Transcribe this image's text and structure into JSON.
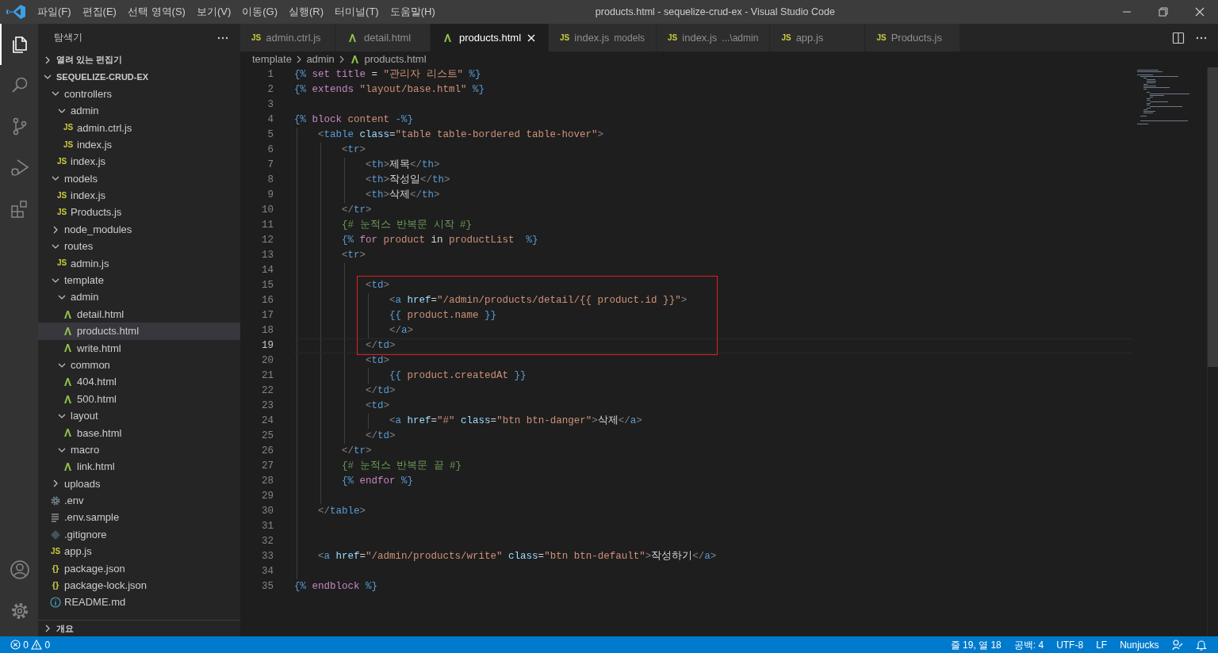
{
  "title_bar": {
    "menu": [
      "파일(F)",
      "편집(E)",
      "선택 영역(S)",
      "보기(V)",
      "이동(G)",
      "실행(R)",
      "터미널(T)",
      "도움말(H)"
    ],
    "title": "products.html - sequelize-crud-ex - Visual Studio Code"
  },
  "activity_bar": {
    "items": [
      {
        "selected": true
      },
      {
        "selected": false
      },
      {
        "selected": false
      },
      {
        "selected": false
      },
      {
        "selected": false
      }
    ]
  },
  "sidebar": {
    "title": "탐색기",
    "sections": [
      {
        "label": "열려 있는 편집기",
        "expanded": false
      },
      {
        "label": "SEQUELIZE-CRUD-EX",
        "expanded": true,
        "children": [
          {
            "label": "controllers",
            "kind": "folder",
            "expanded": true,
            "selected": false,
            "children": [
              {
                "label": "admin",
                "kind": "folder",
                "expanded": true,
                "selected": false,
                "children": [
                  {
                    "label": "admin.ctrl.js",
                    "kind": "js",
                    "badge": "JS",
                    "selected": false
                  },
                  {
                    "label": "index.js",
                    "kind": "js",
                    "badge": "JS",
                    "selected": false
                  }
                ]
              },
              {
                "label": "index.js",
                "kind": "js",
                "badge": "JS",
                "selected": false
              }
            ]
          },
          {
            "label": "models",
            "kind": "folder",
            "expanded": true,
            "selected": false,
            "children": [
              {
                "label": "index.js",
                "kind": "js",
                "badge": "JS",
                "selected": false
              },
              {
                "label": "Products.js",
                "kind": "js",
                "badge": "JS",
                "selected": false
              }
            ]
          },
          {
            "label": "node_modules",
            "kind": "folder",
            "expanded": false,
            "selected": false
          },
          {
            "label": "routes",
            "kind": "folder",
            "expanded": true,
            "selected": false,
            "children": [
              {
                "label": "admin.js",
                "kind": "js",
                "badge": "JS",
                "selected": false
              }
            ]
          },
          {
            "label": "template",
            "kind": "folder",
            "expanded": true,
            "selected": false,
            "children": [
              {
                "label": "admin",
                "kind": "folder",
                "expanded": true,
                "selected": false,
                "children": [
                  {
                    "label": "detail.html",
                    "kind": "nunjucks",
                    "selected": false
                  },
                  {
                    "label": "products.html",
                    "kind": "nunjucks",
                    "selected": true
                  },
                  {
                    "label": "write.html",
                    "kind": "nunjucks",
                    "selected": false
                  }
                ]
              },
              {
                "label": "common",
                "kind": "folder",
                "expanded": true,
                "selected": false,
                "children": [
                  {
                    "label": "404.html",
                    "kind": "nunjucks",
                    "selected": false
                  },
                  {
                    "label": "500.html",
                    "kind": "nunjucks",
                    "selected": false
                  }
                ]
              },
              {
                "label": "layout",
                "kind": "folder",
                "expanded": true,
                "selected": false,
                "children": [
                  {
                    "label": "base.html",
                    "kind": "nunjucks",
                    "selected": false
                  }
                ]
              },
              {
                "label": "macro",
                "kind": "folder",
                "expanded": true,
                "selected": false,
                "children": [
                  {
                    "label": "link.html",
                    "kind": "nunjucks",
                    "selected": false
                  }
                ]
              }
            ]
          },
          {
            "label": "uploads",
            "kind": "folder",
            "expanded": false,
            "selected": false
          },
          {
            "label": ".env",
            "kind": "settings",
            "selected": false
          },
          {
            "label": ".env.sample",
            "kind": "text",
            "selected": false
          },
          {
            "label": ".gitignore",
            "kind": "git",
            "selected": false
          },
          {
            "label": "app.js",
            "kind": "js",
            "badge": "JS",
            "selected": false
          },
          {
            "label": "package.json",
            "kind": "json",
            "badge": "{}",
            "selected": false
          },
          {
            "label": "package-lock.json",
            "kind": "json",
            "badge": "{}",
            "selected": false
          },
          {
            "label": "README.md",
            "kind": "info",
            "selected": false
          }
        ]
      }
    ],
    "outline": {
      "label": "개요",
      "expanded": false
    }
  },
  "tabs": [
    {
      "label": "admin.ctrl.js",
      "kind": "js",
      "badge": "JS",
      "selected": false
    },
    {
      "label": "detail.html",
      "kind": "nunjucks",
      "selected": false
    },
    {
      "label": "products.html",
      "kind": "nunjucks",
      "selected": true
    },
    {
      "label": "index.js",
      "description": "models",
      "kind": "js",
      "badge": "JS",
      "selected": false
    },
    {
      "label": "index.js",
      "description": "...\\admin",
      "kind": "js",
      "badge": "JS",
      "selected": false
    },
    {
      "label": "app.js",
      "kind": "js",
      "badge": "JS",
      "selected": false
    },
    {
      "label": "Products.js",
      "kind": "js",
      "badge": "JS",
      "selected": false
    }
  ],
  "breadcrumb": [
    {
      "label": "template",
      "kind": "folder"
    },
    {
      "label": "admin",
      "kind": "folder"
    },
    {
      "label": "products.html",
      "kind": "nunjucks"
    }
  ],
  "editor": {
    "lines": [
      {
        "number": "1",
        "boxed": false,
        "current": false,
        "tokens": [
          {
            "kind": "delim",
            "text": "{% "
          },
          {
            "kind": "keyword",
            "text": "set title"
          },
          {
            "kind": "text",
            "text": " = "
          },
          {
            "kind": "string",
            "text": "\"관리자 리스트\""
          },
          {
            "kind": "delim",
            "text": " %}"
          }
        ]
      },
      {
        "number": "2",
        "boxed": false,
        "current": false,
        "tokens": [
          {
            "kind": "delim",
            "text": "{% "
          },
          {
            "kind": "keyword",
            "text": "extends "
          },
          {
            "kind": "string",
            "text": "\"layout/base.html\""
          },
          {
            "kind": "delim",
            "text": " %}"
          }
        ]
      },
      {
        "number": "3",
        "boxed": false,
        "current": false
      },
      {
        "number": "4",
        "boxed": false,
        "current": false,
        "tokens": [
          {
            "kind": "delim",
            "text": "{% "
          },
          {
            "kind": "keyword",
            "text": "block "
          },
          {
            "kind": "var",
            "text": "content "
          },
          {
            "kind": "delim",
            "text": "-%}"
          }
        ]
      },
      {
        "number": "5",
        "boxed": false,
        "current": false,
        "tokens": [
          {
            "kind": "punct",
            "text": "    <"
          },
          {
            "kind": "tag",
            "text": "table"
          },
          {
            "kind": "attr",
            "text": " class"
          },
          {
            "kind": "text",
            "text": "="
          },
          {
            "kind": "string",
            "text": "\"table table-bordered table-hover\""
          },
          {
            "kind": "punct",
            "text": ">"
          }
        ]
      },
      {
        "number": "6",
        "boxed": false,
        "current": false,
        "tokens": [
          {
            "kind": "punct",
            "text": "        <"
          },
          {
            "kind": "tag",
            "text": "tr"
          },
          {
            "kind": "punct",
            "text": ">"
          }
        ]
      },
      {
        "number": "7",
        "boxed": false,
        "current": false,
        "tokens": [
          {
            "kind": "punct",
            "text": "            <"
          },
          {
            "kind": "tag",
            "text": "th"
          },
          {
            "kind": "punct",
            "text": ">"
          },
          {
            "kind": "text",
            "text": "제목"
          },
          {
            "kind": "punct",
            "text": "</"
          },
          {
            "kind": "tag",
            "text": "th"
          },
          {
            "kind": "punct",
            "text": ">"
          }
        ]
      },
      {
        "number": "8",
        "boxed": false,
        "current": false,
        "tokens": [
          {
            "kind": "punct",
            "text": "            <"
          },
          {
            "kind": "tag",
            "text": "th"
          },
          {
            "kind": "punct",
            "text": ">"
          },
          {
            "kind": "text",
            "text": "작성일"
          },
          {
            "kind": "punct",
            "text": "</"
          },
          {
            "kind": "tag",
            "text": "th"
          },
          {
            "kind": "punct",
            "text": ">"
          }
        ]
      },
      {
        "number": "9",
        "boxed": false,
        "current": false,
        "tokens": [
          {
            "kind": "punct",
            "text": "            <"
          },
          {
            "kind": "tag",
            "text": "th"
          },
          {
            "kind": "punct",
            "text": ">"
          },
          {
            "kind": "text",
            "text": "삭제"
          },
          {
            "kind": "punct",
            "text": "</"
          },
          {
            "kind": "tag",
            "text": "th"
          },
          {
            "kind": "punct",
            "text": ">"
          }
        ]
      },
      {
        "number": "10",
        "boxed": false,
        "current": false,
        "tokens": [
          {
            "kind": "punct",
            "text": "        </"
          },
          {
            "kind": "tag",
            "text": "tr"
          },
          {
            "kind": "punct",
            "text": ">"
          }
        ]
      },
      {
        "number": "11",
        "boxed": false,
        "current": false,
        "tokens": [
          {
            "kind": "comment",
            "text": "        {# 눈적스 반복문 시작 #}"
          }
        ]
      },
      {
        "number": "12",
        "boxed": false,
        "current": false,
        "tokens": [
          {
            "kind": "delim",
            "text": "        {% "
          },
          {
            "kind": "keyword",
            "text": "for "
          },
          {
            "kind": "var",
            "text": "product "
          },
          {
            "kind": "text",
            "text": "in "
          },
          {
            "kind": "var",
            "text": "productList  "
          },
          {
            "kind": "delim",
            "text": "%}"
          }
        ]
      },
      {
        "number": "13",
        "boxed": false,
        "current": false,
        "tokens": [
          {
            "kind": "punct",
            "text": "        <"
          },
          {
            "kind": "tag",
            "text": "tr"
          },
          {
            "kind": "punct",
            "text": ">"
          }
        ]
      },
      {
        "number": "14",
        "boxed": false,
        "current": false
      },
      {
        "number": "15",
        "boxed": true,
        "current": false,
        "tokens": [
          {
            "kind": "punct",
            "text": "            <"
          },
          {
            "kind": "tag",
            "text": "td"
          },
          {
            "kind": "punct",
            "text": ">"
          }
        ]
      },
      {
        "number": "16",
        "boxed": true,
        "current": false,
        "tokens": [
          {
            "kind": "punct",
            "text": "                <"
          },
          {
            "kind": "tag",
            "text": "a"
          },
          {
            "kind": "attr",
            "text": " href"
          },
          {
            "kind": "text",
            "text": "="
          },
          {
            "kind": "string",
            "text": "\"/admin/products/detail/{{ product.id }}\""
          },
          {
            "kind": "punct",
            "text": ">"
          }
        ]
      },
      {
        "number": "17",
        "boxed": true,
        "current": false,
        "tokens": [
          {
            "kind": "delim",
            "text": "                {{ "
          },
          {
            "kind": "var",
            "text": "product.name "
          },
          {
            "kind": "delim",
            "text": "}}"
          }
        ]
      },
      {
        "number": "18",
        "boxed": true,
        "current": false,
        "tokens": [
          {
            "kind": "punct",
            "text": "                </"
          },
          {
            "kind": "tag",
            "text": "a"
          },
          {
            "kind": "punct",
            "text": ">"
          }
        ]
      },
      {
        "number": "19",
        "boxed": true,
        "current": true,
        "tokens": [
          {
            "kind": "punct",
            "text": "            </"
          },
          {
            "kind": "tag",
            "text": "td"
          },
          {
            "kind": "punct",
            "text": ">"
          }
        ]
      },
      {
        "number": "20",
        "boxed": false,
        "current": false,
        "tokens": [
          {
            "kind": "punct",
            "text": "            <"
          },
          {
            "kind": "tag",
            "text": "td"
          },
          {
            "kind": "punct",
            "text": ">"
          }
        ]
      },
      {
        "number": "21",
        "boxed": false,
        "current": false,
        "tokens": [
          {
            "kind": "delim",
            "text": "                {{ "
          },
          {
            "kind": "var",
            "text": "product.createdAt "
          },
          {
            "kind": "delim",
            "text": "}}"
          }
        ]
      },
      {
        "number": "22",
        "boxed": false,
        "current": false,
        "tokens": [
          {
            "kind": "punct",
            "text": "            </"
          },
          {
            "kind": "tag",
            "text": "td"
          },
          {
            "kind": "punct",
            "text": ">"
          }
        ]
      },
      {
        "number": "23",
        "boxed": false,
        "current": false,
        "tokens": [
          {
            "kind": "punct",
            "text": "            <"
          },
          {
            "kind": "tag",
            "text": "td"
          },
          {
            "kind": "punct",
            "text": ">"
          }
        ]
      },
      {
        "number": "24",
        "boxed": false,
        "current": false,
        "tokens": [
          {
            "kind": "punct",
            "text": "                <"
          },
          {
            "kind": "tag",
            "text": "a"
          },
          {
            "kind": "attr",
            "text": " href"
          },
          {
            "kind": "text",
            "text": "="
          },
          {
            "kind": "string",
            "text": "\"#\""
          },
          {
            "kind": "attr",
            "text": " class"
          },
          {
            "kind": "text",
            "text": "="
          },
          {
            "kind": "string",
            "text": "\"btn btn-danger\""
          },
          {
            "kind": "punct",
            "text": ">"
          },
          {
            "kind": "text",
            "text": "삭제"
          },
          {
            "kind": "punct",
            "text": "</"
          },
          {
            "kind": "tag",
            "text": "a"
          },
          {
            "kind": "punct",
            "text": ">"
          }
        ]
      },
      {
        "number": "25",
        "boxed": false,
        "current": false,
        "tokens": [
          {
            "kind": "punct",
            "text": "            </"
          },
          {
            "kind": "tag",
            "text": "td"
          },
          {
            "kind": "punct",
            "text": ">"
          }
        ]
      },
      {
        "number": "26",
        "boxed": false,
        "current": false,
        "tokens": [
          {
            "kind": "punct",
            "text": "        </"
          },
          {
            "kind": "tag",
            "text": "tr"
          },
          {
            "kind": "punct",
            "text": ">"
          }
        ]
      },
      {
        "number": "27",
        "boxed": false,
        "current": false,
        "tokens": [
          {
            "kind": "comment",
            "text": "        {# 눈적스 반복문 끝 #}"
          }
        ]
      },
      {
        "number": "28",
        "boxed": false,
        "current": false,
        "tokens": [
          {
            "kind": "delim",
            "text": "        {% "
          },
          {
            "kind": "keyword",
            "text": "endfor "
          },
          {
            "kind": "delim",
            "text": "%}"
          }
        ]
      },
      {
        "number": "29",
        "boxed": false,
        "current": false
      },
      {
        "number": "30",
        "boxed": false,
        "current": false,
        "tokens": [
          {
            "kind": "punct",
            "text": "    </"
          },
          {
            "kind": "tag",
            "text": "table"
          },
          {
            "kind": "punct",
            "text": ">"
          }
        ]
      },
      {
        "number": "31",
        "boxed": false,
        "current": false
      },
      {
        "number": "32",
        "boxed": false,
        "current": false
      },
      {
        "number": "33",
        "boxed": false,
        "current": false,
        "tokens": [
          {
            "kind": "punct",
            "text": "    <"
          },
          {
            "kind": "tag",
            "text": "a"
          },
          {
            "kind": "attr",
            "text": " href"
          },
          {
            "kind": "text",
            "text": "="
          },
          {
            "kind": "string",
            "text": "\"/admin/products/write\""
          },
          {
            "kind": "attr",
            "text": " class"
          },
          {
            "kind": "text",
            "text": "="
          },
          {
            "kind": "string",
            "text": "\"btn btn-default\""
          },
          {
            "kind": "punct",
            "text": ">"
          },
          {
            "kind": "text",
            "text": "작성하기"
          },
          {
            "kind": "punct",
            "text": "</"
          },
          {
            "kind": "tag",
            "text": "a"
          },
          {
            "kind": "punct",
            "text": ">"
          }
        ]
      },
      {
        "number": "34",
        "boxed": false,
        "current": false
      },
      {
        "number": "35",
        "boxed": false,
        "current": false,
        "tokens": [
          {
            "kind": "delim",
            "text": "{% "
          },
          {
            "kind": "keyword",
            "text": "endblock "
          },
          {
            "kind": "delim",
            "text": "%}"
          }
        ]
      }
    ]
  },
  "status_bar": {
    "errors": "0",
    "warnings": "0",
    "items": [
      "줄 19, 열 18",
      "공백: 4",
      "UTF-8",
      "LF",
      "Nunjucks"
    ]
  }
}
